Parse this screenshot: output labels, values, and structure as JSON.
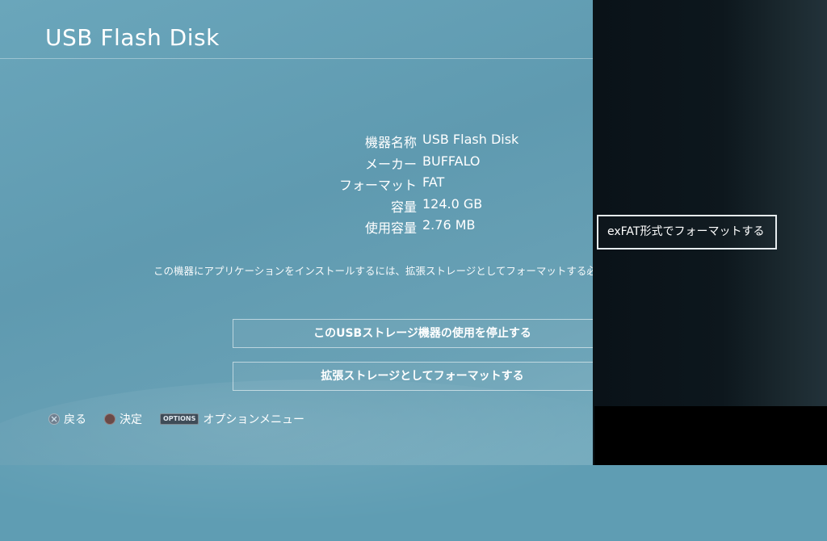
{
  "screen": {
    "title": "USB Flash Disk"
  },
  "device_info": {
    "rows": [
      {
        "label": "機器名称",
        "value": "USB Flash Disk"
      },
      {
        "label": "メーカー",
        "value": "BUFFALO"
      },
      {
        "label": "フォーマット",
        "value": "FAT"
      },
      {
        "label": "容量",
        "value": "124.0 GB"
      },
      {
        "label": "使用容量",
        "value": "2.76 MB"
      }
    ]
  },
  "notice": "この機器にアプリケーションをインストールするには、拡張ストレージとしてフォーマットする必要があります。",
  "buttons": {
    "stop_label": "このUSBストレージ機器の使用を停止する",
    "format_label": "拡張ストレージとしてフォーマットする"
  },
  "footer": {
    "back_label": "戻る",
    "confirm_label": "決定",
    "options_key": "OPTIONS",
    "options_label": "オプションメニュー"
  },
  "options_menu": {
    "items": [
      {
        "label": "exFAT形式でフォーマットする",
        "selected": true
      }
    ]
  },
  "colors": {
    "background": "#5f9db3",
    "panel": "#0d171d",
    "text": "#ffffff"
  }
}
